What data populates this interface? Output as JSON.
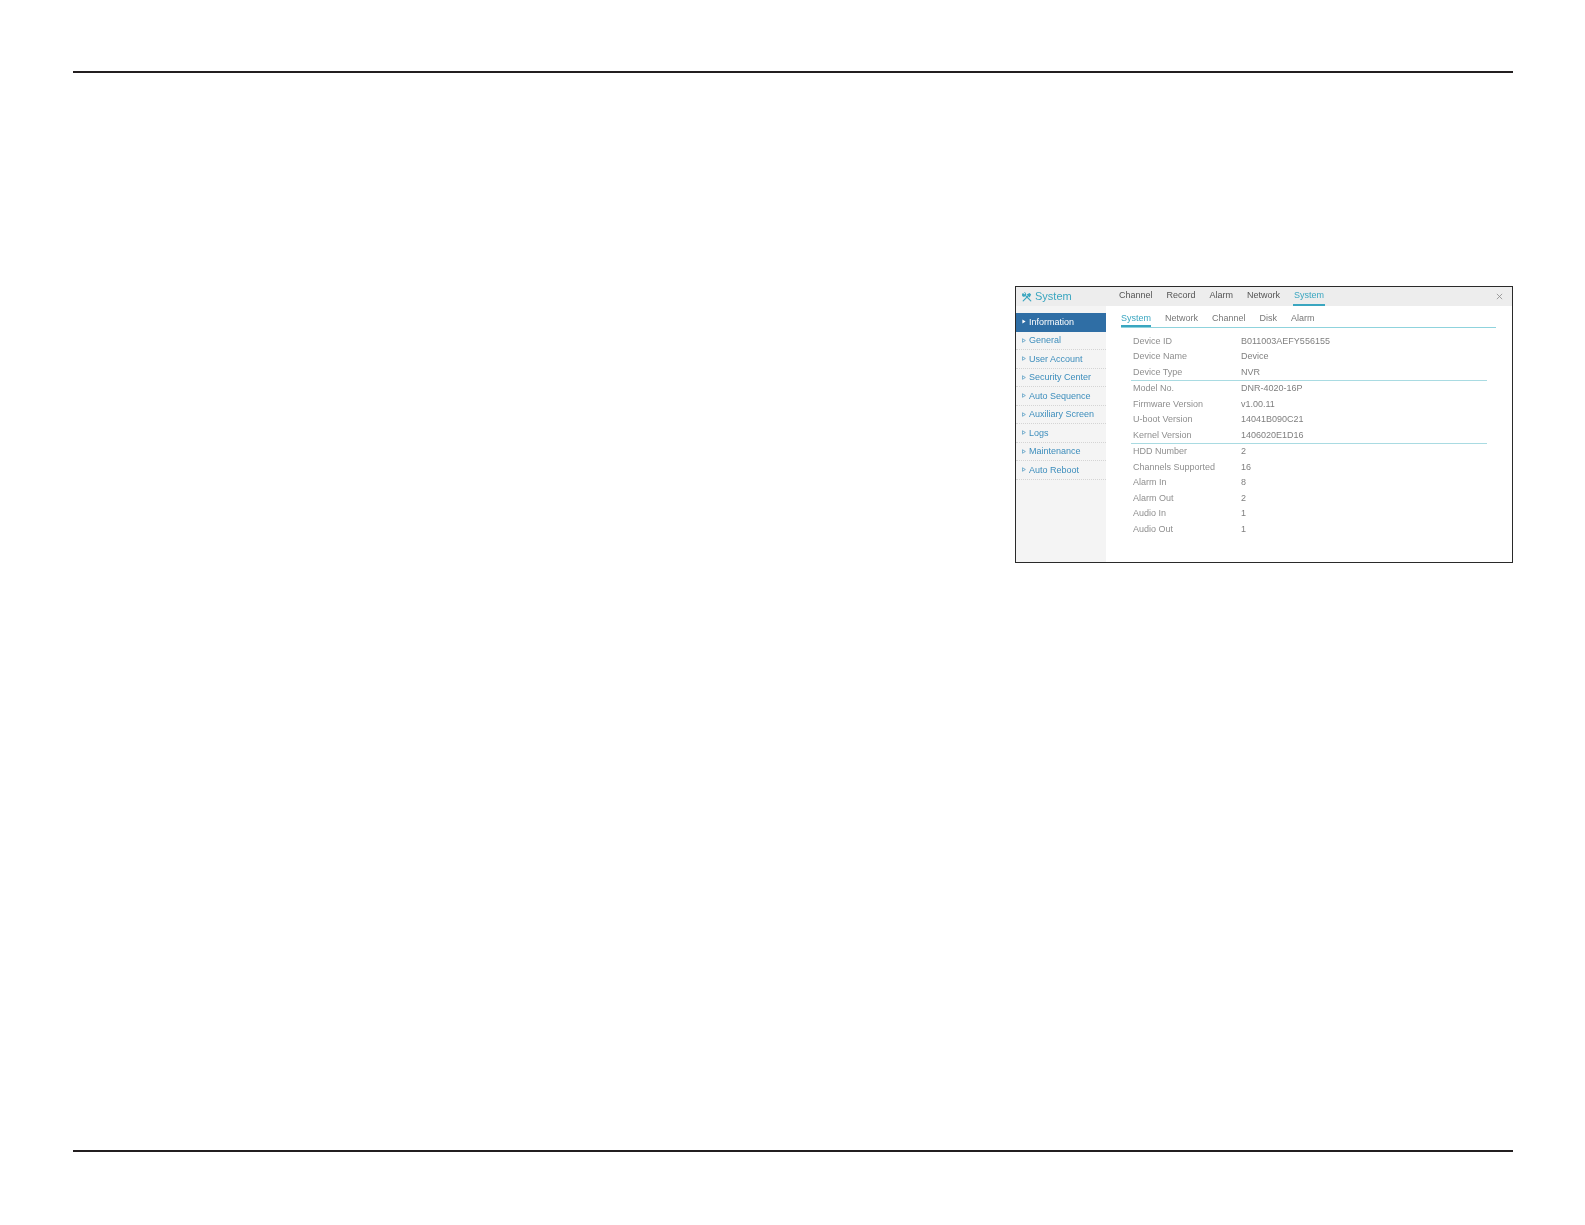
{
  "window": {
    "title": "System"
  },
  "main_tabs": [
    {
      "label": "Channel",
      "selected": false
    },
    {
      "label": "Record",
      "selected": false
    },
    {
      "label": "Alarm",
      "selected": false
    },
    {
      "label": "Network",
      "selected": false
    },
    {
      "label": "System",
      "selected": true
    }
  ],
  "sidebar": {
    "items": [
      {
        "label": "Information",
        "selected": true
      },
      {
        "label": "General",
        "selected": false
      },
      {
        "label": "User Account",
        "selected": false
      },
      {
        "label": "Security Center",
        "selected": false
      },
      {
        "label": "Auto Sequence",
        "selected": false
      },
      {
        "label": "Auxiliary Screen",
        "selected": false
      },
      {
        "label": "Logs",
        "selected": false
      },
      {
        "label": "Maintenance",
        "selected": false
      },
      {
        "label": "Auto Reboot",
        "selected": false
      }
    ]
  },
  "sub_tabs": [
    {
      "label": "System",
      "selected": true
    },
    {
      "label": "Network",
      "selected": false
    },
    {
      "label": "Channel",
      "selected": false
    },
    {
      "label": "Disk",
      "selected": false
    },
    {
      "label": "Alarm",
      "selected": false
    }
  ],
  "info_groups": [
    {
      "rows": [
        {
          "label": "Device ID",
          "value": "B011003AEFY556155"
        },
        {
          "label": "Device Name",
          "value": "Device"
        },
        {
          "label": "Device Type",
          "value": "NVR"
        }
      ]
    },
    {
      "rows": [
        {
          "label": "Model No.",
          "value": "DNR-4020-16P"
        },
        {
          "label": "Firmware Version",
          "value": "v1.00.11"
        },
        {
          "label": "U-boot Version",
          "value": "14041B090C21"
        },
        {
          "label": "Kernel Version",
          "value": "1406020E1D16"
        }
      ]
    },
    {
      "rows": [
        {
          "label": "HDD Number",
          "value": "2"
        },
        {
          "label": "Channels Supported",
          "value": "16"
        },
        {
          "label": "Alarm In",
          "value": "8"
        },
        {
          "label": "Alarm Out",
          "value": "2"
        },
        {
          "label": "Audio In",
          "value": "1"
        },
        {
          "label": "Audio Out",
          "value": "1"
        }
      ]
    }
  ]
}
